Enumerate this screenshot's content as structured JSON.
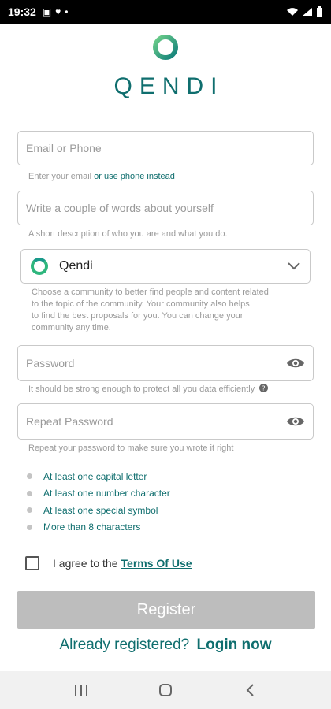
{
  "status_bar": {
    "time": "19:32",
    "dot": "•"
  },
  "logo": {
    "text": "QENDI"
  },
  "email": {
    "placeholder": "Email or Phone",
    "helper": "Enter your email",
    "helper_link": "or use phone instead"
  },
  "about": {
    "placeholder": "Write a couple of words about yourself",
    "helper": "A short description of who you are and what you do."
  },
  "community": {
    "selected": "Qendi",
    "helper_lines": [
      "Choose a community to better find people and content related",
      "to the topic of the community. Your community also helps",
      "to find the best proposals for you. You can change your",
      "community any time."
    ]
  },
  "password": {
    "placeholder": "Password",
    "helper": "It should be strong enough to protect all you data efficiently"
  },
  "repeat_password": {
    "placeholder": "Repeat Password",
    "helper": "Repeat your password to make sure you wrote it right"
  },
  "requirements": [
    "At least one capital letter",
    "At least one number character",
    "At least one special symbol",
    "More than 8 characters"
  ],
  "agree": {
    "text": "I agree to the",
    "terms": "Terms Of Use"
  },
  "register_label": "Register",
  "login_line": {
    "prefix": "Already registered?",
    "link": "Login now"
  },
  "colors": {
    "brand": "#0f6e6e",
    "disabled_button": "#bdbdbd",
    "accent_green": "#2eb67d"
  }
}
